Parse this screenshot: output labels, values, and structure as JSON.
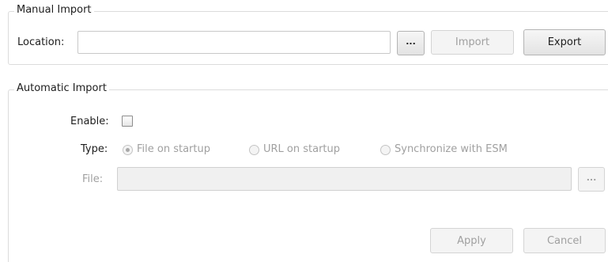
{
  "manual_import": {
    "title": "Manual Import",
    "location_label": "Location:",
    "location_value": "",
    "browse_label": "...",
    "import_label": "Import",
    "export_label": "Export"
  },
  "automatic_import": {
    "title": "Automatic Import",
    "enable_label": "Enable:",
    "enable_checked": false,
    "type_label": "Type:",
    "type_options": [
      {
        "label": "File on startup",
        "selected": true
      },
      {
        "label": "URL on startup",
        "selected": false
      },
      {
        "label": "Synchronize with  ESM",
        "selected": false
      }
    ],
    "file_label": "File:",
    "file_value": "",
    "browse_label": "..."
  },
  "footer": {
    "apply_label": "Apply",
    "cancel_label": "Cancel"
  }
}
